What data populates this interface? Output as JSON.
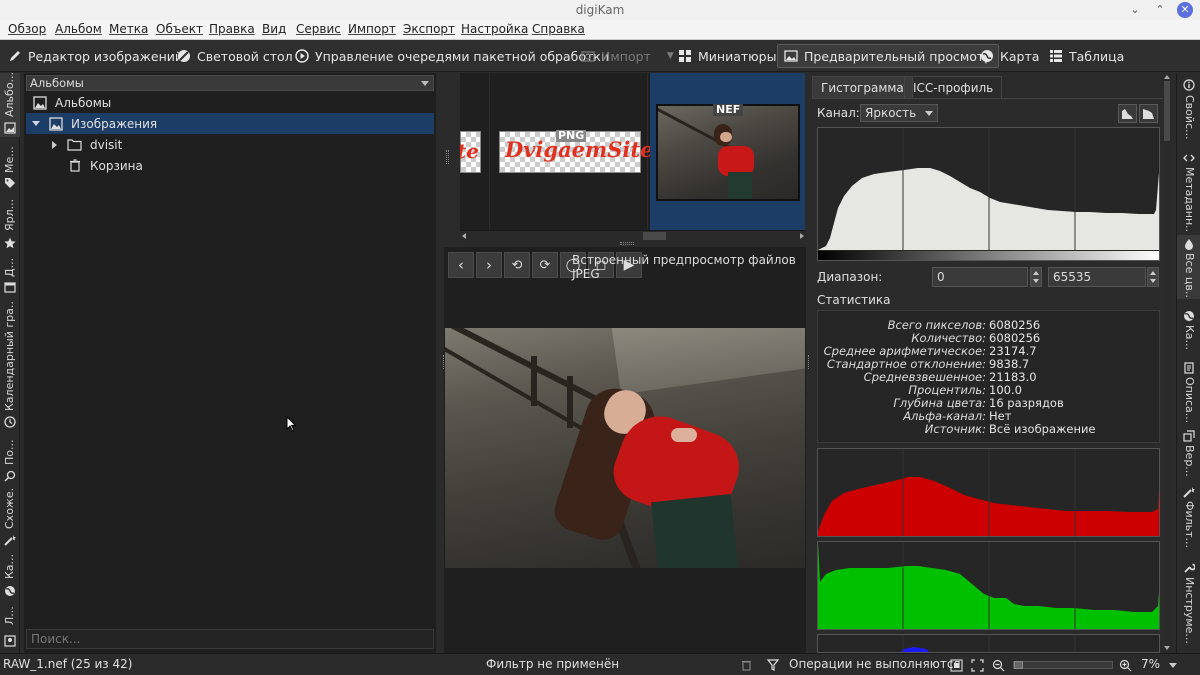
{
  "window": {
    "title": "digiKam"
  },
  "menu": [
    "Обзор",
    "Альбом",
    "Метка",
    "Объект",
    "Правка",
    "Вид",
    "Сервис",
    "Импорт",
    "Экспорт",
    "Настройка",
    "Справка"
  ],
  "toolbar": {
    "image_editor": "Редактор изображений",
    "light_table": "Световой стол",
    "batch_queue": "Управление очередями пакетной обработки",
    "import": "Импорт",
    "thumbnails": "Миниатюры",
    "preview": "Предварительный просмотр",
    "map": "Карта",
    "table": "Таблица"
  },
  "left_tabs": [
    "Альбо...",
    "Ме...",
    "Ярл...",
    "Д...",
    "Календарный гра...",
    "По...",
    "Схоже...",
    "Ка...",
    "Л..."
  ],
  "left_panel": {
    "header": "Альбомы",
    "tree": {
      "root": "Альбомы",
      "images": "Изображения",
      "dvisit": "dvisit",
      "trash": "Корзина"
    },
    "search_placeholder": "Поиск..."
  },
  "thumbnails": {
    "png_badge": "PNG",
    "nef_badge": "NEF",
    "logo_text": "DvigaemSite",
    "logo_partial": "te"
  },
  "preview": {
    "caption": "Встроенный предпросмотр файлов JPEG"
  },
  "right_panel": {
    "tabs": [
      "Гистограмма",
      "ICC-профиль"
    ],
    "channel_label": "Канал:",
    "channel_value": "Яркость",
    "range_label": "Диапазон:",
    "range_min": "0",
    "range_max": "65535",
    "stats_title": "Статистика",
    "stats": [
      {
        "label": "Всего пикселов:",
        "value": "6080256"
      },
      {
        "label": "Количество:",
        "value": "6080256"
      },
      {
        "label": "Среднее арифметическое:",
        "value": "23174.7"
      },
      {
        "label": "Стандартное отклонение:",
        "value": "9838.7"
      },
      {
        "label": "Средневзвешенное:",
        "value": "21183.0"
      },
      {
        "label": "Процентиль:",
        "value": "100.0"
      },
      {
        "label": "Глубина цвета:",
        "value": "16 разрядов"
      },
      {
        "label": "Альфа-канал:",
        "value": "Нет"
      },
      {
        "label": "Источник:",
        "value": "Всё изображение"
      }
    ]
  },
  "right_tabs": [
    "Свойс...",
    "Метаданн...",
    "Все цв...",
    "Ка...",
    "Описа...",
    "Вер...",
    "Фильт...",
    "Инструме..."
  ],
  "statusbar": {
    "file": "RAW_1.nef (25 из 42)",
    "filter": "Фильтр не применён",
    "operations": "Операции не выполняются",
    "zoom": "7%"
  },
  "colors": {
    "selection": "#1b3d66",
    "panel_bg": "#1f1f1f",
    "red_channel": "#cc0000",
    "green_channel": "#00c000",
    "blue_channel": "#1a1aff",
    "luminosity": "#e6e6e2"
  }
}
